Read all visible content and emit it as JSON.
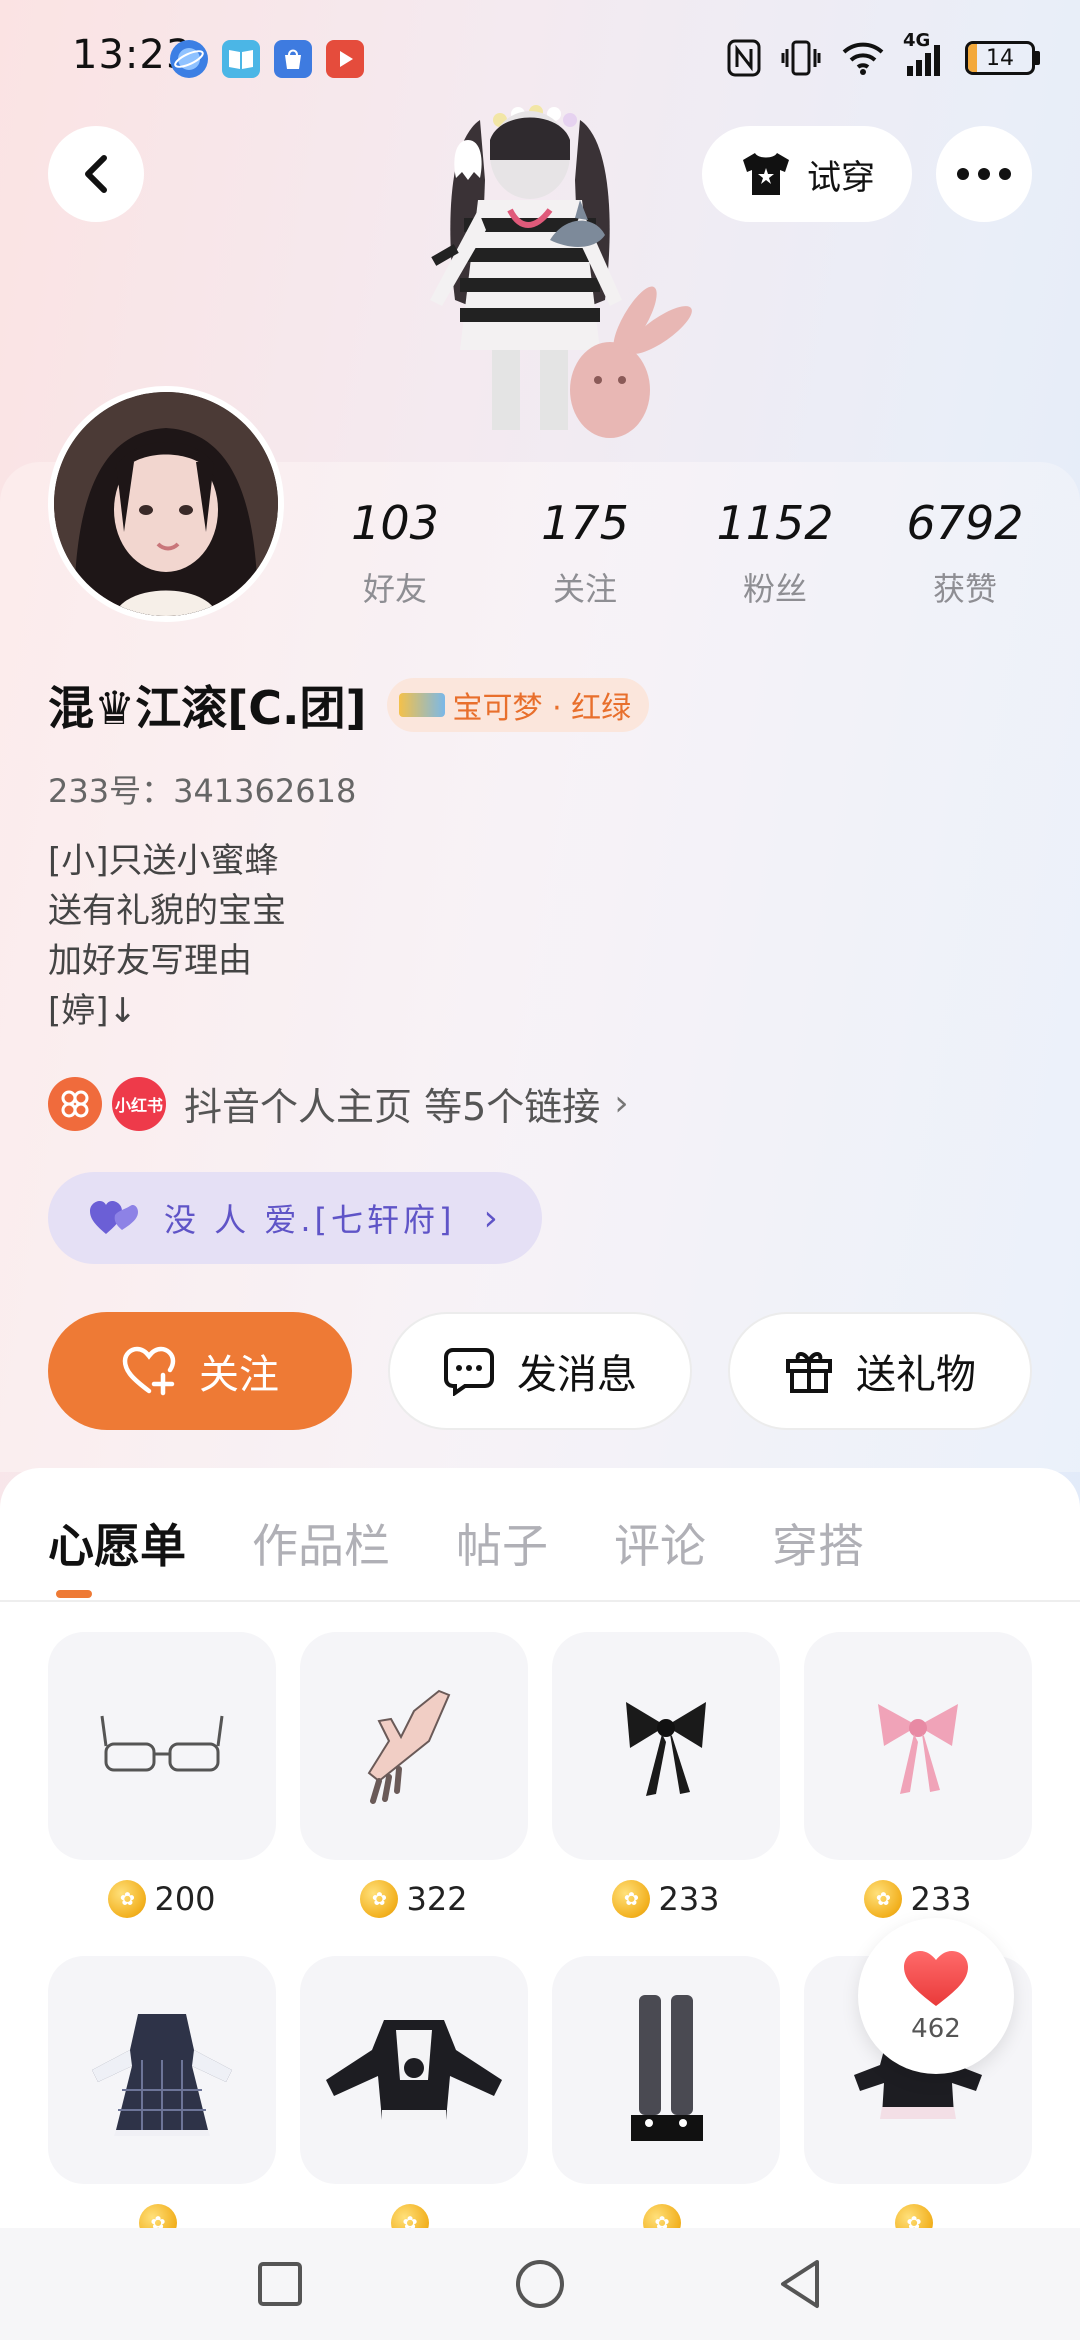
{
  "status_bar": {
    "time": "13:23",
    "network": "4G",
    "battery": "14",
    "battery_level_percent": 14,
    "notification_icons": [
      "browser-icon",
      "book-icon",
      "store-icon",
      "video-icon"
    ],
    "system_icons": [
      "nfc-icon",
      "vibrate-icon",
      "wifi-icon",
      "signal-icon",
      "battery-icon"
    ]
  },
  "header": {
    "try_on_label": "试穿",
    "icons": [
      "back-icon",
      "tshirt-icon",
      "more-icon"
    ]
  },
  "profile": {
    "stats": [
      {
        "value": "103",
        "label": "好友"
      },
      {
        "value": "175",
        "label": "关注"
      },
      {
        "value": "1152",
        "label": "粉丝"
      },
      {
        "value": "6792",
        "label": "获赞"
      }
    ],
    "nickname": "混♛江滚[C.团]",
    "game_tag": "宝可梦 · 红绿",
    "uid": "233号：341362618",
    "bio": [
      "[小]只送小蜜蜂",
      "送有礼貌的宝宝",
      "加好友写理由",
      "[婷]↓"
    ],
    "links": {
      "apps": [
        {
          "icon": "douyin-icon",
          "text": "",
          "color": "#f06b3c"
        },
        {
          "icon": "xiaohongshu-icon",
          "text": "小红书",
          "color": "#ee3a4a"
        }
      ],
      "text": "抖音个人主页 等5个链接"
    },
    "group": {
      "text": "没 人 爱.[七轩府]",
      "color": "#5f54c7"
    }
  },
  "actions": {
    "follow": "关注",
    "message": "发消息",
    "gift": "送礼物"
  },
  "tabs": [
    {
      "label": "心愿单",
      "active": true
    },
    {
      "label": "作品栏",
      "active": false
    },
    {
      "label": "帖子",
      "active": false
    },
    {
      "label": "评论",
      "active": false
    },
    {
      "label": "穿搭",
      "active": false
    }
  ],
  "wishlist": [
    {
      "name": "glasses",
      "price": "200"
    },
    {
      "name": "hand",
      "price": "322"
    },
    {
      "name": "black-bow",
      "price": "233"
    },
    {
      "name": "pink-bow",
      "price": "233"
    },
    {
      "name": "plaid-dress",
      "price": ""
    },
    {
      "name": "maid-sweater",
      "price": ""
    },
    {
      "name": "stockings-shoes",
      "price": ""
    },
    {
      "name": "black-dress",
      "price": ""
    }
  ],
  "like_button": {
    "count": "462"
  },
  "colors": {
    "accent": "#ee7a35",
    "group_purple": "#5f54c7"
  }
}
